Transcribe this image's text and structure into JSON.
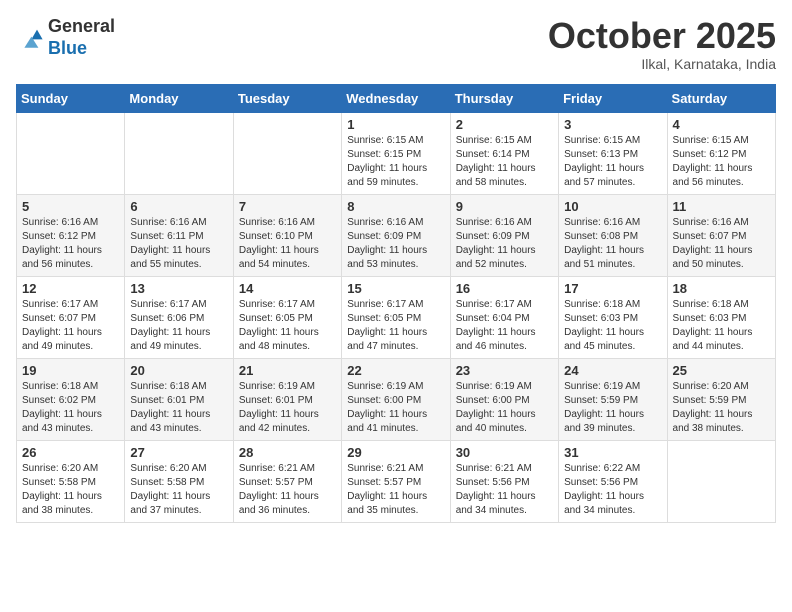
{
  "header": {
    "logo_line1": "General",
    "logo_line2": "Blue",
    "month": "October 2025",
    "location": "Ilkal, Karnataka, India"
  },
  "weekdays": [
    "Sunday",
    "Monday",
    "Tuesday",
    "Wednesday",
    "Thursday",
    "Friday",
    "Saturday"
  ],
  "weeks": [
    [
      {
        "day": "",
        "info": ""
      },
      {
        "day": "",
        "info": ""
      },
      {
        "day": "",
        "info": ""
      },
      {
        "day": "1",
        "info": "Sunrise: 6:15 AM\nSunset: 6:15 PM\nDaylight: 11 hours\nand 59 minutes."
      },
      {
        "day": "2",
        "info": "Sunrise: 6:15 AM\nSunset: 6:14 PM\nDaylight: 11 hours\nand 58 minutes."
      },
      {
        "day": "3",
        "info": "Sunrise: 6:15 AM\nSunset: 6:13 PM\nDaylight: 11 hours\nand 57 minutes."
      },
      {
        "day": "4",
        "info": "Sunrise: 6:15 AM\nSunset: 6:12 PM\nDaylight: 11 hours\nand 56 minutes."
      }
    ],
    [
      {
        "day": "5",
        "info": "Sunrise: 6:16 AM\nSunset: 6:12 PM\nDaylight: 11 hours\nand 56 minutes."
      },
      {
        "day": "6",
        "info": "Sunrise: 6:16 AM\nSunset: 6:11 PM\nDaylight: 11 hours\nand 55 minutes."
      },
      {
        "day": "7",
        "info": "Sunrise: 6:16 AM\nSunset: 6:10 PM\nDaylight: 11 hours\nand 54 minutes."
      },
      {
        "day": "8",
        "info": "Sunrise: 6:16 AM\nSunset: 6:09 PM\nDaylight: 11 hours\nand 53 minutes."
      },
      {
        "day": "9",
        "info": "Sunrise: 6:16 AM\nSunset: 6:09 PM\nDaylight: 11 hours\nand 52 minutes."
      },
      {
        "day": "10",
        "info": "Sunrise: 6:16 AM\nSunset: 6:08 PM\nDaylight: 11 hours\nand 51 minutes."
      },
      {
        "day": "11",
        "info": "Sunrise: 6:16 AM\nSunset: 6:07 PM\nDaylight: 11 hours\nand 50 minutes."
      }
    ],
    [
      {
        "day": "12",
        "info": "Sunrise: 6:17 AM\nSunset: 6:07 PM\nDaylight: 11 hours\nand 49 minutes."
      },
      {
        "day": "13",
        "info": "Sunrise: 6:17 AM\nSunset: 6:06 PM\nDaylight: 11 hours\nand 49 minutes."
      },
      {
        "day": "14",
        "info": "Sunrise: 6:17 AM\nSunset: 6:05 PM\nDaylight: 11 hours\nand 48 minutes."
      },
      {
        "day": "15",
        "info": "Sunrise: 6:17 AM\nSunset: 6:05 PM\nDaylight: 11 hours\nand 47 minutes."
      },
      {
        "day": "16",
        "info": "Sunrise: 6:17 AM\nSunset: 6:04 PM\nDaylight: 11 hours\nand 46 minutes."
      },
      {
        "day": "17",
        "info": "Sunrise: 6:18 AM\nSunset: 6:03 PM\nDaylight: 11 hours\nand 45 minutes."
      },
      {
        "day": "18",
        "info": "Sunrise: 6:18 AM\nSunset: 6:03 PM\nDaylight: 11 hours\nand 44 minutes."
      }
    ],
    [
      {
        "day": "19",
        "info": "Sunrise: 6:18 AM\nSunset: 6:02 PM\nDaylight: 11 hours\nand 43 minutes."
      },
      {
        "day": "20",
        "info": "Sunrise: 6:18 AM\nSunset: 6:01 PM\nDaylight: 11 hours\nand 43 minutes."
      },
      {
        "day": "21",
        "info": "Sunrise: 6:19 AM\nSunset: 6:01 PM\nDaylight: 11 hours\nand 42 minutes."
      },
      {
        "day": "22",
        "info": "Sunrise: 6:19 AM\nSunset: 6:00 PM\nDaylight: 11 hours\nand 41 minutes."
      },
      {
        "day": "23",
        "info": "Sunrise: 6:19 AM\nSunset: 6:00 PM\nDaylight: 11 hours\nand 40 minutes."
      },
      {
        "day": "24",
        "info": "Sunrise: 6:19 AM\nSunset: 5:59 PM\nDaylight: 11 hours\nand 39 minutes."
      },
      {
        "day": "25",
        "info": "Sunrise: 6:20 AM\nSunset: 5:59 PM\nDaylight: 11 hours\nand 38 minutes."
      }
    ],
    [
      {
        "day": "26",
        "info": "Sunrise: 6:20 AM\nSunset: 5:58 PM\nDaylight: 11 hours\nand 38 minutes."
      },
      {
        "day": "27",
        "info": "Sunrise: 6:20 AM\nSunset: 5:58 PM\nDaylight: 11 hours\nand 37 minutes."
      },
      {
        "day": "28",
        "info": "Sunrise: 6:21 AM\nSunset: 5:57 PM\nDaylight: 11 hours\nand 36 minutes."
      },
      {
        "day": "29",
        "info": "Sunrise: 6:21 AM\nSunset: 5:57 PM\nDaylight: 11 hours\nand 35 minutes."
      },
      {
        "day": "30",
        "info": "Sunrise: 6:21 AM\nSunset: 5:56 PM\nDaylight: 11 hours\nand 34 minutes."
      },
      {
        "day": "31",
        "info": "Sunrise: 6:22 AM\nSunset: 5:56 PM\nDaylight: 11 hours\nand 34 minutes."
      },
      {
        "day": "",
        "info": ""
      }
    ]
  ]
}
